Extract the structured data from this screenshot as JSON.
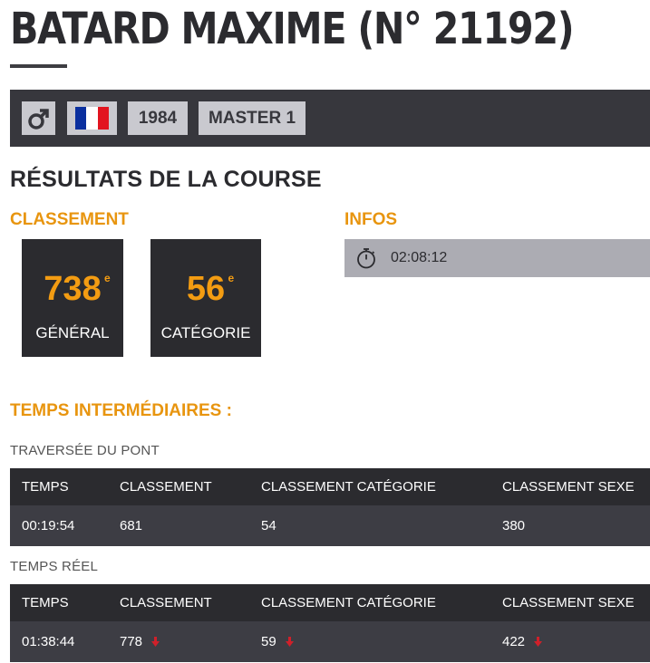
{
  "athlete": {
    "name": "BATARD MAXIME (N° 21192)",
    "gender_icon": "male-symbol-icon",
    "flag_icon": "france-flag-icon",
    "flag_colors": [
      "#0a2f9e",
      "#ffffff",
      "#e2141f"
    ],
    "birth_year": "1984",
    "category": "MASTER 1"
  },
  "results": {
    "section_title": "RÉSULTATS DE LA COURSE",
    "classement_title": "CLASSEMENT",
    "infos_title": "INFOS",
    "general": {
      "value": "738",
      "suffix": "e",
      "label": "GÉNÉRAL"
    },
    "categorie": {
      "value": "56",
      "suffix": "e",
      "label": "CATÉGORIE"
    },
    "time_icon": "stopwatch-icon",
    "time": "02:08:12"
  },
  "splits": {
    "title": "TEMPS INTERMÉDIAIRES :",
    "headers": [
      "TEMPS",
      "CLASSEMENT",
      "CLASSEMENT CATÉGORIE",
      "CLASSEMENT SEXE"
    ],
    "items": [
      {
        "name": "TRAVERSÉE DU PONT",
        "temps": "00:19:54",
        "classement": "681",
        "classement_categorie": "54",
        "classement_sexe": "380"
      },
      {
        "name": "TEMPS RÉEL",
        "temps": "01:38:44",
        "classement": "778",
        "classement_categorie": "59",
        "classement_sexe": "422",
        "trend_icon": "arrow-down-icon"
      }
    ]
  },
  "colors": {
    "accent": "#f39c12",
    "dark": "#2b2b2f",
    "bar": "#37373d",
    "down_arrow": "#d0202a"
  }
}
